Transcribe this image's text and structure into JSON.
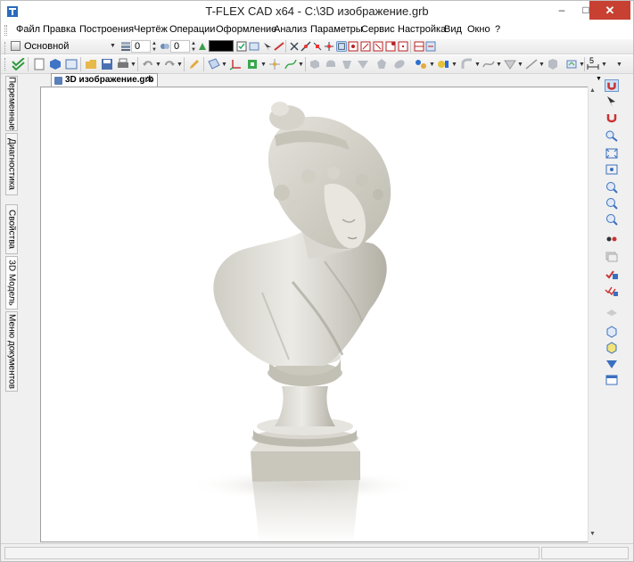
{
  "window": {
    "title": "T-FLEX CAD x64 - C:\\3D изображение.grb",
    "minimize": "–",
    "maximize": "□",
    "close": "✕"
  },
  "menu": {
    "items": [
      "Файл",
      "Правка",
      "Построения",
      "Чертёж",
      "Операции",
      "Оформление",
      "Анализ",
      "Параметры",
      "Сервис",
      "Настройка",
      "Вид",
      "Окно",
      "?"
    ]
  },
  "toolbar1": {
    "layer_name": "Основной",
    "field1_value": "0",
    "field2_value": "0",
    "color_value": "#000000"
  },
  "toolbar2": {
    "dimension_value": "5"
  },
  "document": {
    "tab_label": "3D изображение.grb",
    "tab_close": "✕"
  },
  "left_panel": {
    "tabs": [
      "Переменные",
      "Диагностика",
      "Свойства",
      "3D Модель",
      "Меню документов"
    ]
  },
  "colors": {
    "accent": "#3a6fbf",
    "bust_light": "#ecebe6",
    "bust_mid": "#cfcdc4",
    "bust_shadow": "#a9a69b"
  }
}
